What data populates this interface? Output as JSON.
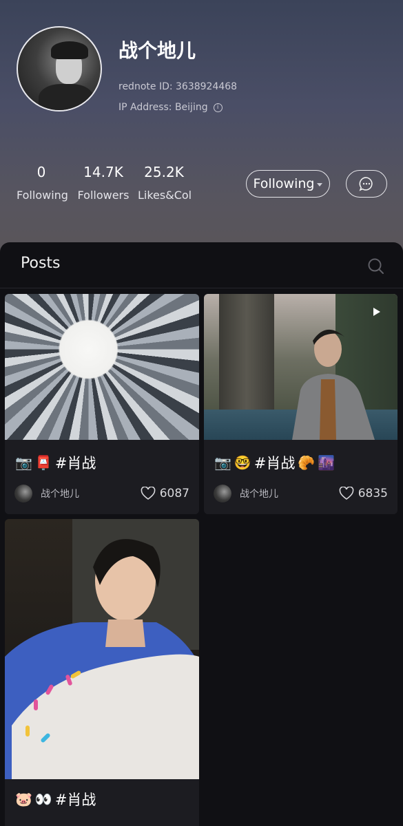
{
  "profile": {
    "nickname": "战个地儿",
    "rednote_id": "rednote ID: 3638924468",
    "ip_address": "IP Address: Beijing"
  },
  "stats": [
    {
      "value": "0",
      "label": "Following"
    },
    {
      "value": "14.7K",
      "label": "Followers"
    },
    {
      "value": "25.2K",
      "label": "Likes&Col"
    }
  ],
  "actions": {
    "follow_label": "Following"
  },
  "posts_section": {
    "title": "Posts"
  },
  "posts": [
    {
      "title": "#肖战",
      "emojis": [
        "📷",
        "📮"
      ],
      "author": "战个地儿",
      "likes": "6087"
    },
    {
      "title": "#肖战",
      "emojis": [
        "📷",
        "🤓"
      ],
      "trailing_emojis": [
        "🥐",
        "🌆"
      ],
      "author": "战个地儿",
      "likes": "6835",
      "is_video": true
    },
    {
      "title": "#肖战",
      "emojis": [
        "🐷",
        "👀"
      ]
    }
  ],
  "icons": {
    "search": "search-icon",
    "message": "chat-bubble-icon",
    "like": "heart-icon",
    "info": "info-icon",
    "play": "play-icon"
  }
}
